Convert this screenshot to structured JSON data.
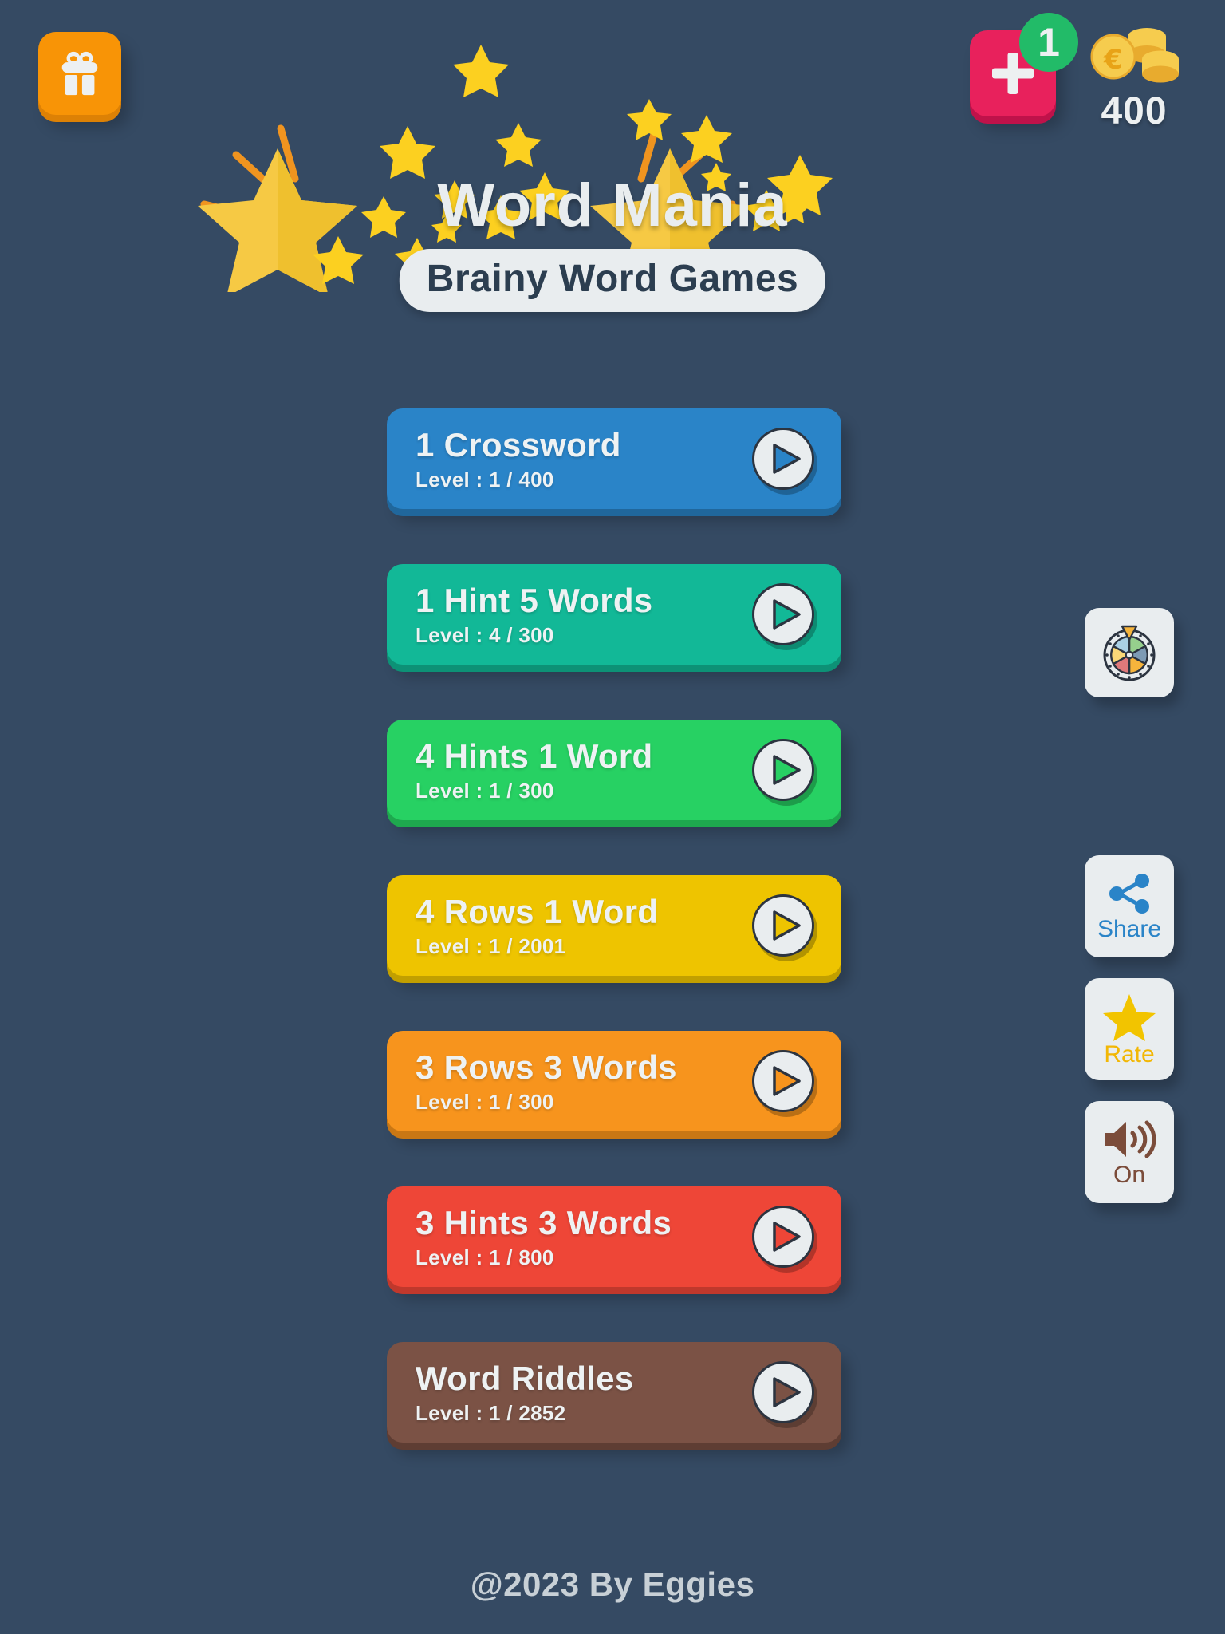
{
  "app": {
    "title": "Word Mania",
    "subtitle": "Brainy Word Games",
    "background_color": "#354a63"
  },
  "topbar": {
    "gift_icon": "gift-icon",
    "add_coins": {
      "icon": "plus-icon",
      "badge_count": "1",
      "badge_color": "#22bb68",
      "button_color": "#e8215c"
    },
    "coins": {
      "icon": "coin-stack-icon",
      "currency_symbol": "€",
      "amount": "400"
    }
  },
  "menu": {
    "level_prefix": "Level : ",
    "items": [
      {
        "title": "1 Crossword",
        "level": "Level : 1 / 400",
        "current": "1",
        "total": "400",
        "color": "#2a84c8",
        "shadow": "#20679c",
        "play_icon": "play-icon"
      },
      {
        "title": "1 Hint 5 Words",
        "level": "Level : 4 / 300",
        "current": "4",
        "total": "300",
        "color": "#12b897",
        "shadow": "#0d9176",
        "play_icon": "play-icon"
      },
      {
        "title": "4 Hints 1 Word",
        "level": "Level : 1 / 300",
        "current": "1",
        "total": "300",
        "color": "#27d163",
        "shadow": "#1ea84e",
        "play_icon": "play-icon"
      },
      {
        "title": "4 Rows 1 Word",
        "level": "Level : 1 / 2001",
        "current": "1",
        "total": "2001",
        "color": "#eec400",
        "shadow": "#c19f00",
        "play_icon": "play-icon"
      },
      {
        "title": "3 Rows 3 Words",
        "level": "Level : 1 / 300",
        "current": "1",
        "total": "300",
        "color": "#f7941d",
        "shadow": "#c97714",
        "play_icon": "play-icon"
      },
      {
        "title": "3 Hints 3 Words",
        "level": "Level : 1 / 800",
        "current": "1",
        "total": "800",
        "color": "#ee4637",
        "shadow": "#c0382c",
        "play_icon": "play-icon"
      },
      {
        "title": "Word Riddles",
        "level": "Level : 1 / 2852",
        "current": "1",
        "total": "2852",
        "color": "#7b5245",
        "shadow": "#5e3d33",
        "play_icon": "play-icon"
      }
    ]
  },
  "side_buttons": {
    "spin": {
      "icon": "fortune-wheel-icon",
      "label": ""
    },
    "share": {
      "icon": "share-icon",
      "label": "Share",
      "color": "#2a84c8"
    },
    "rate": {
      "icon": "star-icon",
      "label": "Rate",
      "color": "#f2b705"
    },
    "sound": {
      "icon": "speaker-on-icon",
      "label": "On",
      "color": "#7b4c3a"
    }
  },
  "footer": {
    "copyright": "@2023 By Eggies"
  }
}
